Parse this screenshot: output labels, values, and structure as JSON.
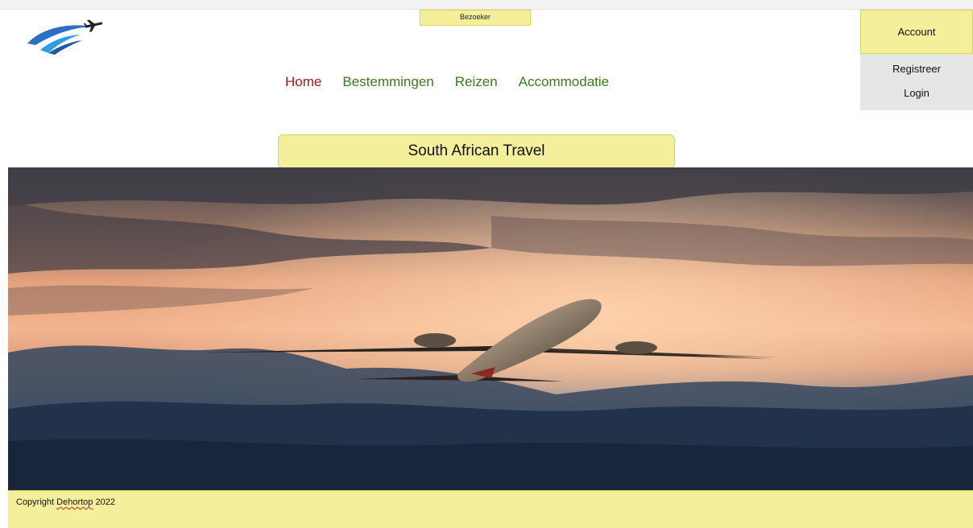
{
  "header": {
    "logo": "plane-logo",
    "role_badge": "Bezoeker"
  },
  "nav": {
    "items": [
      {
        "label": "Home",
        "color": "#a01c1c"
      },
      {
        "label": "Bestemmingen",
        "color": "#3a7a1e"
      },
      {
        "label": "Reizen",
        "color": "#3a7a1e"
      },
      {
        "label": "Accommodatie",
        "color": "#3a7a1e"
      }
    ]
  },
  "account": {
    "label": "Account",
    "menu": [
      {
        "label": "Registreer"
      },
      {
        "label": "Login"
      }
    ]
  },
  "main": {
    "title": "South African Travel",
    "hero_image": "airplane-sunset-hero"
  },
  "footer": {
    "copyright_prefix": "Copyright ",
    "copyright_name": "Dehortop",
    "copyright_year": " 2022"
  },
  "colors": {
    "accent_yellow": "#f3ef9b",
    "accent_border": "#d9d35a",
    "nav_active": "#a01c1c",
    "nav_link": "#3a7a1e"
  }
}
